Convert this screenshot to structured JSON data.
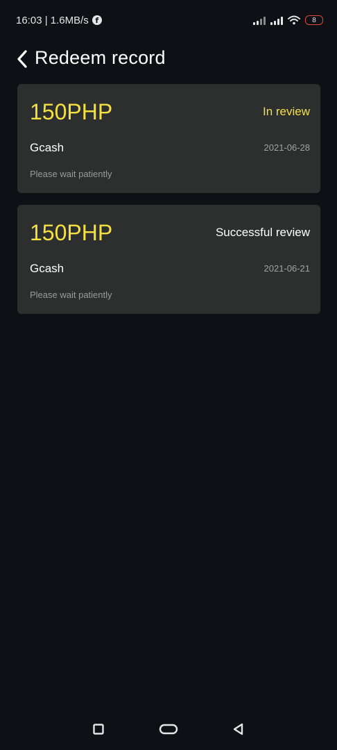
{
  "status_bar": {
    "time_speed": "16:03 | 1.6MB/s",
    "facebook_icon": "f",
    "battery": "8"
  },
  "header": {
    "title": "Redeem record",
    "back_icon": "chevron-left-icon"
  },
  "records": [
    {
      "amount": "150PHP",
      "status": "In review",
      "method": "Gcash",
      "date": "2021-06-28",
      "note": "Please wait patiently"
    },
    {
      "amount": "150PHP",
      "status": "Successful review",
      "method": "Gcash",
      "date": "2021-06-21",
      "note": "Please wait patiently"
    }
  ],
  "colors": {
    "background": "#0e1015",
    "card": "#2d2f2f",
    "accent": "#f4e13f",
    "battery_border": "#e04a3c"
  },
  "nav_bar": {
    "icons": [
      "square-recent-apps-icon",
      "home-pill-icon",
      "back-triangle-icon"
    ]
  }
}
